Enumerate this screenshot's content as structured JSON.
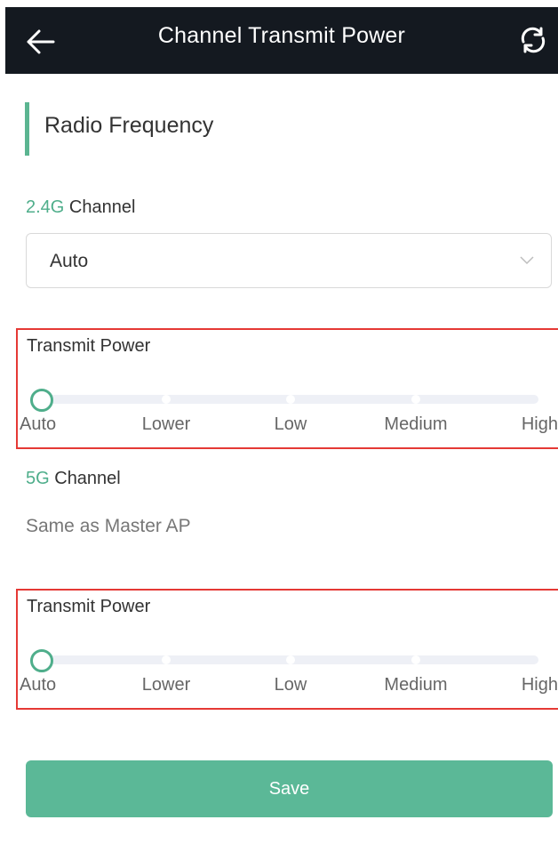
{
  "header": {
    "title": "Channel Transmit Power",
    "back_icon": "arrow-left-icon",
    "refresh_icon": "refresh-icon"
  },
  "section": {
    "title": "Radio Frequency"
  },
  "channel_24g": {
    "label_accent": "2.4G",
    "label_rest": " Channel",
    "selected_value": "Auto",
    "dropdown_icon": "chevron-down-icon"
  },
  "power_24g": {
    "label": "Transmit Power",
    "options": [
      "Auto",
      "Lower",
      "Low",
      "Medium",
      "High"
    ],
    "selected": "Auto"
  },
  "channel_5g": {
    "label_accent": "5G",
    "label_rest": " Channel",
    "value": "Same as Master AP"
  },
  "power_5g": {
    "label": "Transmit Power",
    "options": [
      "Auto",
      "Lower",
      "Low",
      "Medium",
      "High"
    ],
    "selected": "Auto"
  },
  "actions": {
    "save_label": "Save"
  },
  "colors": {
    "accent": "#4fae8b",
    "header_bg": "#141920",
    "highlight_border": "#e53935",
    "save_bg": "#5bb897"
  }
}
